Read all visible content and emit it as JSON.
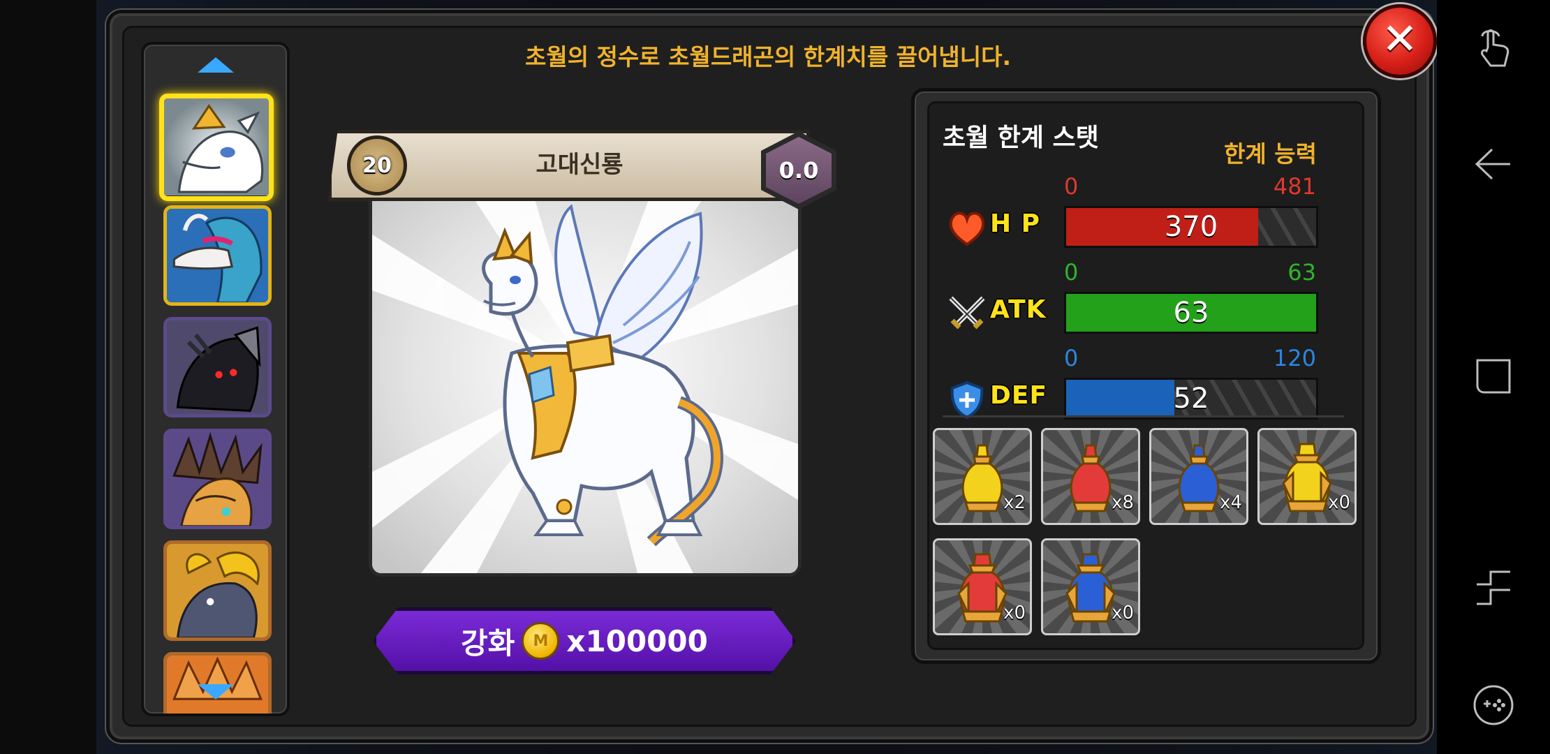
{
  "header": {
    "message": "초월의 정수로 초월드래곤의 한계치를 끌어냅니다.",
    "close_symbol": "✕"
  },
  "dragon_list": {
    "scroll_up_icon": "arrow-up-icon",
    "scroll_down_icon": "arrow-down-icon",
    "portraits": [
      {
        "name": "white-gold-dragon",
        "selected": true
      },
      {
        "name": "blue-maned-dragon",
        "selected": false
      },
      {
        "name": "black-dragon",
        "selected": false
      },
      {
        "name": "spiked-brown-dragon",
        "selected": false
      },
      {
        "name": "gold-horned-dragon",
        "selected": false
      },
      {
        "name": "orange-dragon",
        "selected": false
      }
    ]
  },
  "dragon": {
    "level": "20",
    "name": "고대신룡",
    "grade": "0.0"
  },
  "enhance": {
    "label": "강화",
    "coin_icon": "M",
    "cost": "x100000"
  },
  "stats": {
    "title": "초월 한계 스탯",
    "limit_label": "한계 능력",
    "rows": [
      {
        "name": "H P",
        "min": "0",
        "max": "481",
        "value": "370",
        "fraction": 0.769,
        "color": "#c01f17",
        "min_color": "#e0382f",
        "max_color": "#e0382f",
        "icon": "heart-icon"
      },
      {
        "name": "ATK",
        "min": "0",
        "max": "63",
        "value": "63",
        "fraction": 1.0,
        "color": "#23a11a",
        "min_color": "#2fb52a",
        "max_color": "#2fb52a",
        "icon": "crossed-swords-icon"
      },
      {
        "name": "DEF",
        "min": "0",
        "max": "120",
        "value": "52",
        "fraction": 0.433,
        "color": "#1a63b8",
        "min_color": "#2a86e0",
        "max_color": "#2a86e0",
        "icon": "shield-icon"
      }
    ]
  },
  "items": [
    {
      "name": "yellow-essence-small",
      "qty": "x2",
      "color": "#f2d21c"
    },
    {
      "name": "red-essence-small",
      "qty": "x8",
      "color": "#e33a3a"
    },
    {
      "name": "blue-essence-small",
      "qty": "x4",
      "color": "#2a5fd6"
    },
    {
      "name": "yellow-essence-large",
      "qty": "x0",
      "color": "#f2d21c"
    },
    {
      "name": "red-essence-large",
      "qty": "x0",
      "color": "#e33a3a"
    },
    {
      "name": "blue-essence-large",
      "qty": "x0",
      "color": "#2a5fd6"
    }
  ],
  "navbar": {
    "icons": [
      "touch-icon",
      "back-icon",
      "recents-icon",
      "split-screen-icon",
      "game-tools-icon"
    ]
  }
}
